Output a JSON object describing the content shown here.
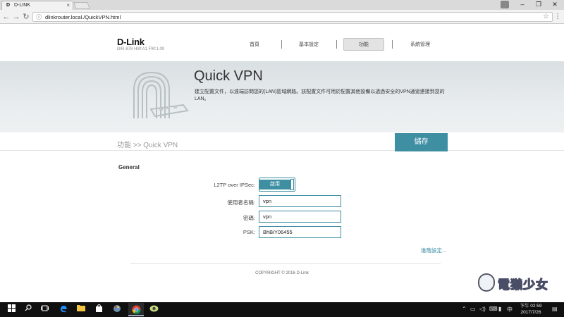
{
  "browser": {
    "tab_title": "D-LINK",
    "tab_favicon": "D",
    "tab_close": "×",
    "url": "dlinkrouter.local./QuickVPN.html",
    "back_icon": "←",
    "forward_icon": "→",
    "reload_icon": "↻",
    "info_icon": "ⓘ",
    "star_icon": "☆",
    "menu_icon": "⋮",
    "minimize_icon": "–",
    "maximize_icon": "❐",
    "close_icon": "✕"
  },
  "router": {
    "brand": "D-Link",
    "model": "DIR-878 HW:A1 FW:1.00",
    "nav": [
      "首頁",
      "基本設定",
      "功能",
      "系統管理"
    ],
    "active_nav_index": 2,
    "page_title": "Quick VPN",
    "description": "建立配置文件，以遠端訪問您的(LAN)區域網路。該配置文件可用於配置其他設備以透過安全的VPN通道連接到您的LAN。",
    "breadcrumb": "功能 >> Quick VPN",
    "save_label": "儲存",
    "section_title": "General",
    "l2tp_label": "L2TP over IPSec:",
    "l2tp_value": "啟用",
    "username_label": "使用者名稱:",
    "username_value": "vpn",
    "password_label": "密碼:",
    "password_value": "vpn",
    "psk_label": "PSK:",
    "psk_value": "BhBiY06455",
    "advanced_link": "進階設定...",
    "copyright": "COPYRIGHT © 2016 D-Link",
    "accent_color": "#3f8fa3"
  },
  "watermark": {
    "text": "電獺少女"
  },
  "taskbar": {
    "time": "下午 02:59",
    "date": "2017/7/26"
  }
}
